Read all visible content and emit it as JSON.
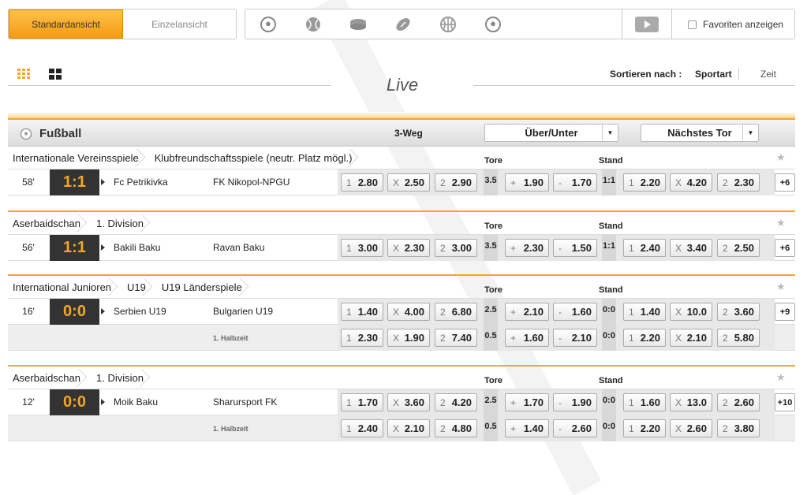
{
  "view": {
    "standard": "Standardansicht",
    "single": "Einzelansicht"
  },
  "favorites_label": "Favoriten anzeigen",
  "live_title": "Live",
  "sort": {
    "label": "Sortieren nach :",
    "sport": "Sportart",
    "time": "Zeit"
  },
  "section": {
    "title": "Fußball",
    "three_way": "3-Weg",
    "market1": "Über/Unter",
    "market2": "Nächstes Tor"
  },
  "col": {
    "tore": "Tore",
    "stand": "Stand"
  },
  "groups": [
    {
      "crumbs": [
        "Internationale Vereinsspiele",
        "Klubfreundschaftsspiele (neutr. Platz mögl.)"
      ],
      "rows": [
        {
          "min": "58'",
          "score": "1:1",
          "team1": "Fc Petrikivka",
          "team2": "FK Nikopol-NPGU",
          "o1": "2.80",
          "ox": "2.50",
          "o2": "2.90",
          "line": "3.5",
          "plus": "1.90",
          "minus": "1.70",
          "stand": "1:1",
          "n1": "2.20",
          "nx": "4.20",
          "n2": "2.30",
          "more": "+6"
        }
      ]
    },
    {
      "crumbs": [
        "Aserbaidschan",
        "1. Division"
      ],
      "rows": [
        {
          "min": "56'",
          "score": "1:1",
          "team1": "Bakili Baku",
          "team2": "Ravan Baku",
          "o1": "3.00",
          "ox": "2.30",
          "o2": "3.00",
          "line": "3.5",
          "plus": "2.30",
          "minus": "1.50",
          "stand": "1:1",
          "n1": "2.40",
          "nx": "3.40",
          "n2": "2.50",
          "more": "+6"
        }
      ]
    },
    {
      "crumbs": [
        "International Junioren",
        "U19",
        "U19 Länderspiele"
      ],
      "rows": [
        {
          "min": "16'",
          "score": "0:0",
          "team1": "Serbien U19",
          "team2": "Bulgarien U19",
          "o1": "1.40",
          "ox": "4.00",
          "o2": "6.80",
          "line": "2.5",
          "plus": "2.10",
          "minus": "1.60",
          "stand": "0:0",
          "n1": "1.40",
          "nx": "10.0",
          "n2": "3.60",
          "more": "+9"
        },
        {
          "half": "1. Halbzeit",
          "o1": "2.30",
          "ox": "1.90",
          "o2": "7.40",
          "line": "0.5",
          "plus": "1.60",
          "minus": "2.10",
          "stand": "0:0",
          "n1": "2.20",
          "nx": "2.10",
          "n2": "5.80"
        }
      ]
    },
    {
      "crumbs": [
        "Aserbaidschan",
        "1. Division"
      ],
      "rows": [
        {
          "min": "12'",
          "score": "0:0",
          "team1": "Moik Baku",
          "team2": "Sharursport FK",
          "o1": "1.70",
          "ox": "3.60",
          "o2": "4.20",
          "line": "2.5",
          "plus": "1.70",
          "minus": "1.90",
          "stand": "0:0",
          "n1": "1.60",
          "nx": "13.0",
          "n2": "2.60",
          "more": "+10"
        },
        {
          "half": "1. Halbzeit",
          "o1": "2.40",
          "ox": "2.10",
          "o2": "4.80",
          "line": "0.5",
          "plus": "1.40",
          "minus": "2.60",
          "stand": "0:0",
          "n1": "2.20",
          "nx": "2.60",
          "n2": "3.80"
        }
      ]
    }
  ]
}
